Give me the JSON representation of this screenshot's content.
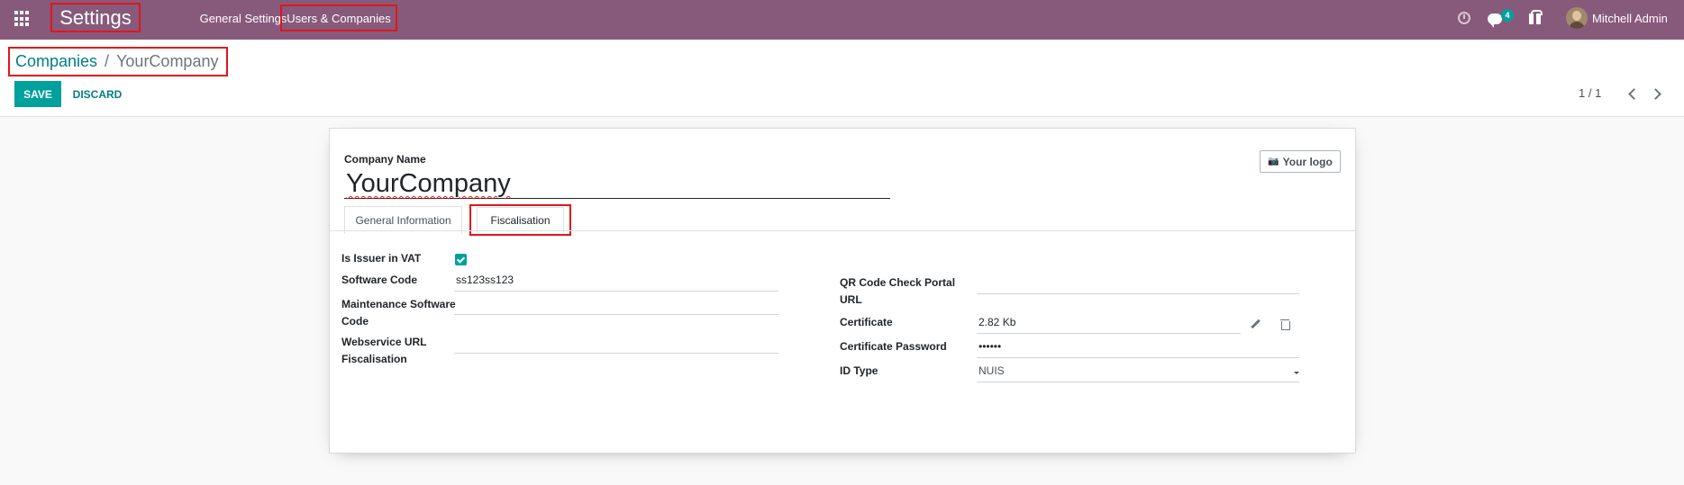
{
  "navbar": {
    "app_title": "Settings",
    "menu": [
      "General Settings",
      "Users & Companies"
    ],
    "chat_badge": "4",
    "user_name": "Mitchell Admin"
  },
  "breadcrumb": {
    "parent": "Companies",
    "separator": "/",
    "current": "YourCompany"
  },
  "actions": {
    "save": "SAVE",
    "discard": "DISCARD"
  },
  "pager": {
    "value": "1 / 1"
  },
  "form": {
    "company_name_label": "Company Name",
    "company_name": "YourCompany",
    "logo_button": "Your logo",
    "tabs": [
      "General Information",
      "Fiscalisation"
    ],
    "left_fields": {
      "is_issuer_label": "Is Issuer in VAT",
      "is_issuer_checked": true,
      "software_code_label": "Software Code",
      "software_code_value": "ss123ss123",
      "maintenance_label_1": "Maintenance Software",
      "maintenance_label_2": "Code",
      "maintenance_value": "",
      "webservice_label_1": "Webservice URL",
      "webservice_label_2": "Fiscalisation",
      "webservice_value": ""
    },
    "right_fields": {
      "qr_label_1": "QR Code Check Portal",
      "qr_label_2": "URL",
      "qr_value": "",
      "certificate_label": "Certificate",
      "certificate_value": "2.82 Kb",
      "cert_password_label": "Certificate Password",
      "cert_password_value": "••••••",
      "id_type_label": "ID Type",
      "id_type_value": "NUIS"
    }
  },
  "colors": {
    "navbar": "#875a7b",
    "primary": "#00a09d",
    "link": "#017e84",
    "highlight_box": "#e0161b"
  },
  "icons": [
    "apps-grid-icon",
    "clock-icon",
    "chat-icon",
    "gift-icon",
    "chevron-left-icon",
    "chevron-right-icon",
    "camera-icon",
    "pencil-icon",
    "trash-icon",
    "caret-down-icon"
  ]
}
